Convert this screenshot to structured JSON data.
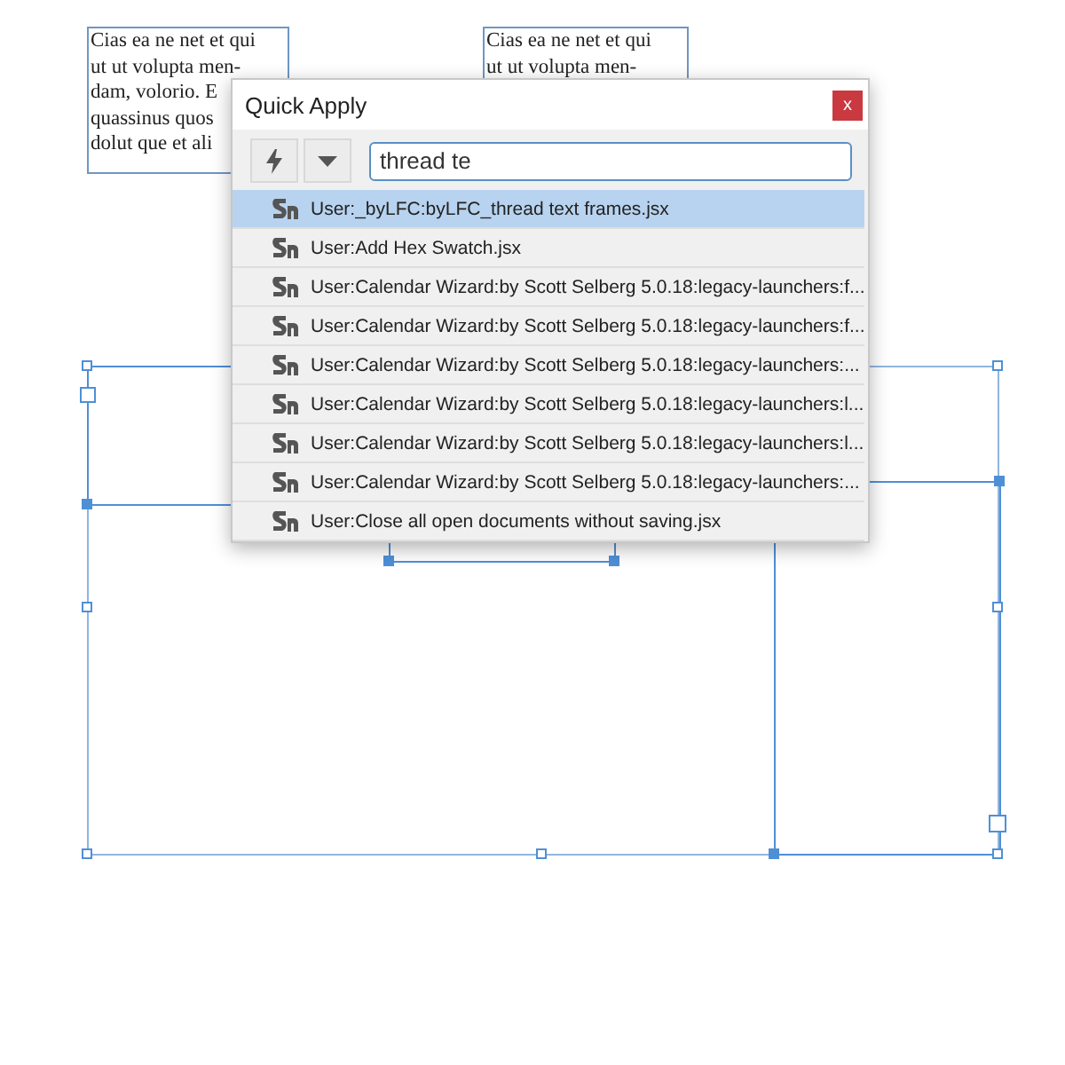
{
  "canvas": {
    "text_frames": [
      {
        "lines": [
          "Cias ea ne net et qui",
          "ut ut volupta men-",
          "dam, volorio. E",
          "quassinus quos",
          "dolut que et ali"
        ]
      },
      {
        "lines": [
          "Cias ea ne net et qui",
          "ut ut volupta men-"
        ]
      }
    ]
  },
  "dialog": {
    "title": "Quick Apply",
    "close": "x",
    "search": {
      "value": "thread te"
    },
    "results": [
      {
        "label": "User:_byLFC:byLFC_thread text frames.jsx",
        "selected": true
      },
      {
        "label": "User:Add Hex Swatch.jsx",
        "selected": false
      },
      {
        "label": "User:Calendar Wizard:by Scott Selberg  5.0.18:legacy-launchers:f...",
        "selected": false
      },
      {
        "label": "User:Calendar Wizard:by Scott Selberg  5.0.18:legacy-launchers:f...",
        "selected": false
      },
      {
        "label": "User:Calendar Wizard:by Scott Selberg  5.0.18:legacy-launchers:...",
        "selected": false
      },
      {
        "label": "User:Calendar Wizard:by Scott Selberg  5.0.18:legacy-launchers:l...",
        "selected": false
      },
      {
        "label": "User:Calendar Wizard:by Scott Selberg  5.0.18:legacy-launchers:l...",
        "selected": false
      },
      {
        "label": "User:Calendar Wizard:by Scott Selberg  5.0.18:legacy-launchers:...",
        "selected": false
      },
      {
        "label": "User:Close all open documents without saving.jsx",
        "selected": false
      }
    ]
  }
}
